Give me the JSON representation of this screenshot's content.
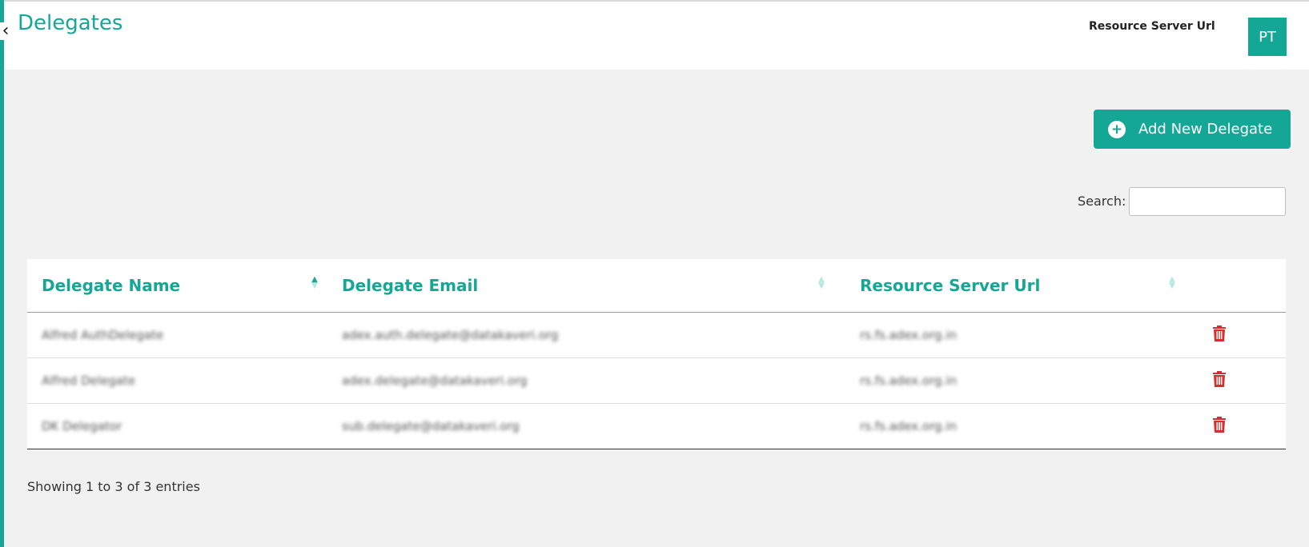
{
  "header": {
    "title": "Delegates",
    "resource_server_label": "Resource Server Url",
    "avatar_initials": "PT"
  },
  "actions": {
    "add_label": "Add New Delegate"
  },
  "search": {
    "label": "Search:",
    "value": ""
  },
  "table": {
    "columns": [
      "Delegate Name",
      "Delegate Email",
      "Resource Server Url"
    ],
    "rows": [
      {
        "name": "Alfred AuthDelegate",
        "email": "adex.auth.delegate@datakaveri.org",
        "url": "rs.fs.adex.org.in"
      },
      {
        "name": "Alfred Delegate",
        "email": "adex.delegate@datakaveri.org",
        "url": "rs.fs.adex.org.in"
      },
      {
        "name": "DK Delegator",
        "email": "sub.delegate@datakaveri.org",
        "url": "rs.fs.adex.org.in"
      }
    ]
  },
  "footer": {
    "info": "Showing 1 to 3 of 3 entries"
  },
  "colors": {
    "accent": "#14a796",
    "delete": "#d32f2f"
  },
  "icons": {
    "back": "chevron-left-icon",
    "add": "plus-circle-icon",
    "delete": "trash-icon",
    "sort": "sort-icon"
  }
}
